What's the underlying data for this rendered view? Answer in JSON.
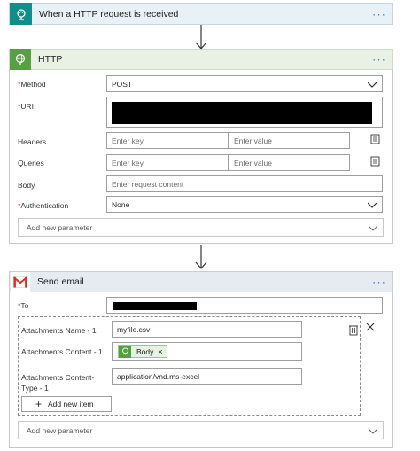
{
  "trigger": {
    "title": "When a HTTP request is received",
    "icon": "http-request-trigger-icon",
    "color": "#0f8e8c",
    "bg": "#e7f1f6"
  },
  "http_action": {
    "title": "HTTP",
    "icon": "http-globe-icon",
    "color": "#56a043",
    "bg": "#e9f1e4",
    "fields": {
      "method_label": "Method",
      "method_value": "POST",
      "uri_label": "URI",
      "headers_label": "Headers",
      "headers_key_placeholder": "Enter key",
      "headers_value_placeholder": "Enter value",
      "queries_label": "Queries",
      "queries_key_placeholder": "Enter key",
      "queries_value_placeholder": "Enter value",
      "body_label": "Body",
      "body_placeholder": "Enter request content",
      "auth_label": "Authentication",
      "auth_value": "None"
    },
    "add_param": "Add new parameter"
  },
  "email_action": {
    "title": "Send email",
    "icon": "gmail-icon",
    "bg": "#e6eaf1",
    "to_label": "To",
    "attachments": {
      "name_label": "Attachments Name - 1",
      "name_value": "myfile.csv",
      "content_label": "Attachments Content - 1",
      "content_token": "Body",
      "content_type_label": "Attachments Content-Type - 1",
      "content_type_value": "application/vnd.ms-excel",
      "add_item": "Add new item"
    },
    "add_param": "Add new parameter"
  },
  "more_label": "···",
  "required_mark": "*"
}
